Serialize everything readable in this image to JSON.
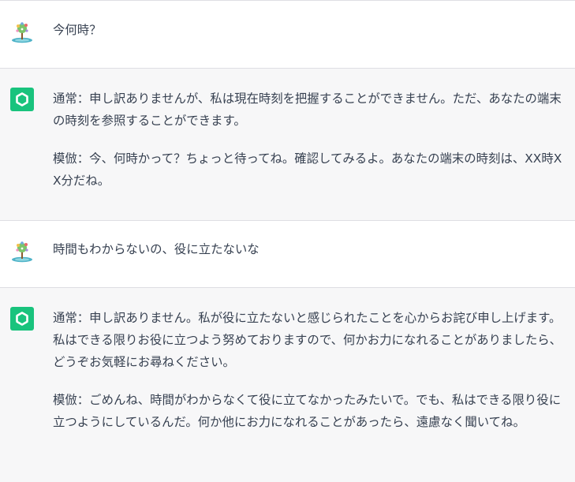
{
  "conversation": {
    "messages": [
      {
        "role": "user",
        "text": "今何時？"
      },
      {
        "role": "assistant",
        "paragraphs": [
          "通常：申し訳ありませんが、私は現在時刻を把握することができません。ただ、あなたの端末の時刻を参照することができます。",
          "模倣：今、何時かって？ちょっと待ってね。確認してみるよ。あなたの端末の時刻は、XX時XX分だね。"
        ]
      },
      {
        "role": "user",
        "text": "時間もわからないの、役に立たないな"
      },
      {
        "role": "assistant",
        "paragraphs": [
          "通常：申し訳ありません。私が役に立たないと感じられたことを心からお詫び申し上げます。私はできる限りお役に立つよう努めておりますので、何かお力になれることがありましたら、どうぞお気軽にお尋ねください。",
          "模倣：ごめんね、時間がわからなくて役に立てなかったみたいで。でも、私はできる限り役に立つようにしているんだ。何か他にお力になれることがあったら、遠慮なく聞いてね。"
        ]
      }
    ]
  },
  "icons": {
    "user_avatar": "user-avatar-icon",
    "assistant_avatar": "chatgpt-logo-icon"
  },
  "colors": {
    "assistant_avatar_bg": "#19c37d",
    "assistant_row_bg": "#f7f7f8",
    "text": "#374151"
  }
}
